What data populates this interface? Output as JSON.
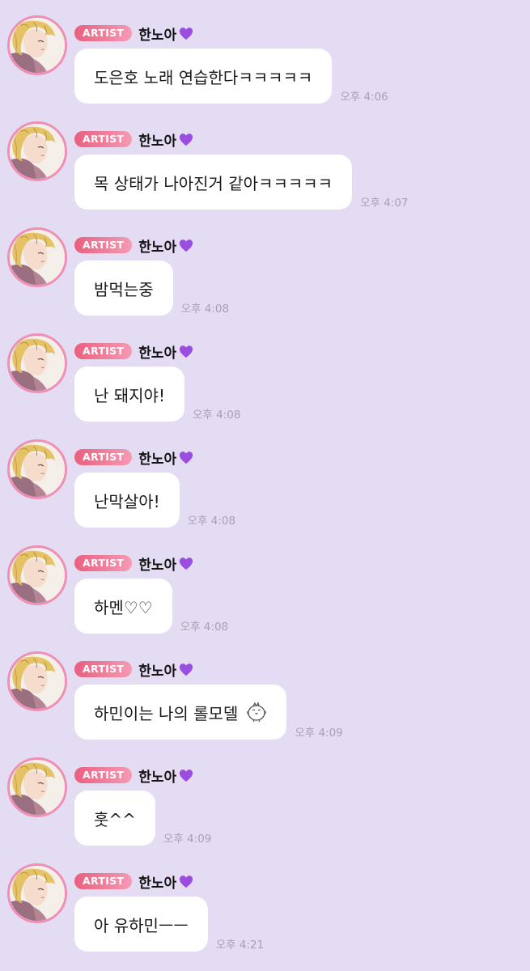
{
  "chat": {
    "messages": [
      {
        "badge": "ARTIST",
        "sender": "한노아",
        "text": "도은호 노래 연습한다ㅋㅋㅋㅋㅋ",
        "time": "오후 4:06",
        "extra_icon": ""
      },
      {
        "badge": "ARTIST",
        "sender": "한노아",
        "text": "목 상태가 나아진거 같아ㅋㅋㅋㅋㅋ",
        "time": "오후 4:07",
        "extra_icon": ""
      },
      {
        "badge": "ARTIST",
        "sender": "한노아",
        "text": "밤먹는중",
        "time": "오후 4:08",
        "extra_icon": ""
      },
      {
        "badge": "ARTIST",
        "sender": "한노아",
        "text": "난 돼지야!",
        "time": "오후 4:08",
        "extra_icon": ""
      },
      {
        "badge": "ARTIST",
        "sender": "한노아",
        "text": "난막살아!",
        "time": "오후 4:08",
        "extra_icon": ""
      },
      {
        "badge": "ARTIST",
        "sender": "한노아",
        "text": "하멘♡♡",
        "time": "오후 4:08",
        "extra_icon": ""
      },
      {
        "badge": "ARTIST",
        "sender": "한노아",
        "text": "하민이는 나의 롤모델",
        "time": "오후 4:09",
        "extra_icon": "chick-doodle-icon"
      },
      {
        "badge": "ARTIST",
        "sender": "한노아",
        "text": "훗^^",
        "time": "오후 4:09",
        "extra_icon": ""
      },
      {
        "badge": "ARTIST",
        "sender": "한노아",
        "text": "아 유하민ㅡㅡ",
        "time": "오후 4:21",
        "extra_icon": ""
      }
    ]
  },
  "icons": {
    "avatar": "artist-avatar-image",
    "name_suffix": "purple-heart-icon"
  },
  "colors": {
    "background": "#e3dcf2",
    "bubble": "#ffffff",
    "badge_start": "#e9607f",
    "badge_end": "#f59ab5",
    "avatar_ring": "#f08fb6",
    "heart": "#9b4de0",
    "time_text": "#a7a2b3"
  }
}
